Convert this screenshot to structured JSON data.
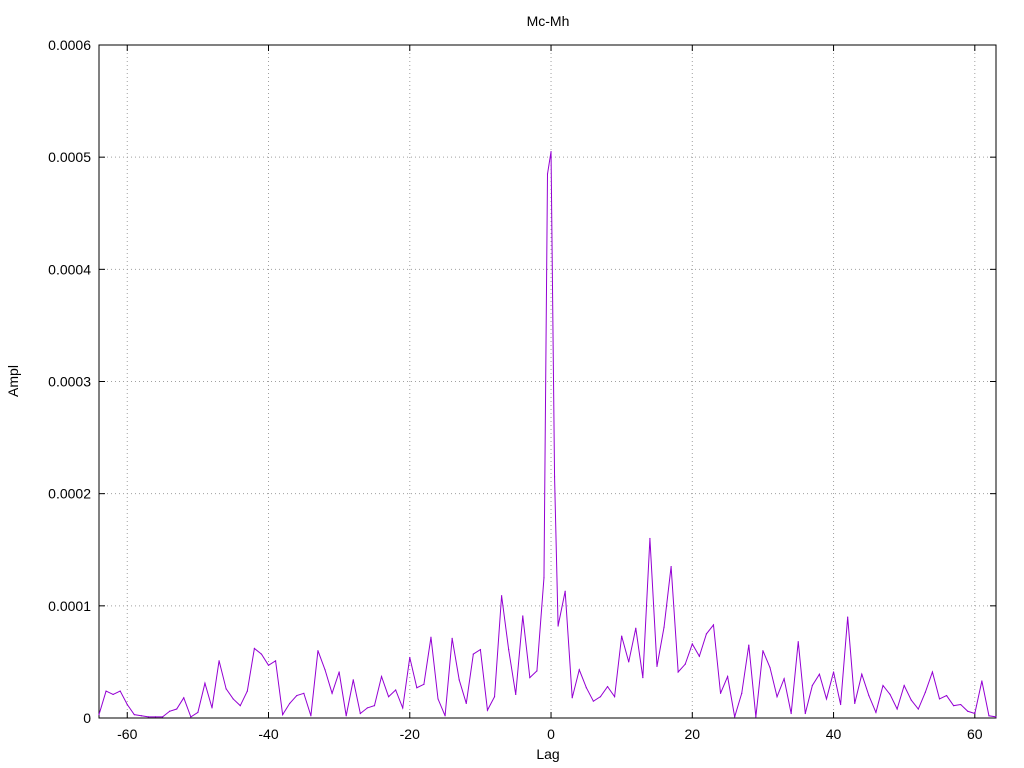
{
  "chart_data": {
    "type": "line",
    "title": "Mc-Mh",
    "xlabel": "Lag",
    "ylabel": "Ampl",
    "xlim": [
      -64,
      63
    ],
    "ylim": [
      0,
      0.0006
    ],
    "grid": true,
    "x_ticks": [
      -60,
      -40,
      -20,
      0,
      20,
      40,
      60
    ],
    "y_ticks": [
      0,
      0.0001,
      0.0002,
      0.0003,
      0.0004,
      0.0005,
      0.0006
    ],
    "x_tick_labels": [
      "-60",
      "-40",
      "-20",
      "0",
      "20",
      "40",
      "60"
    ],
    "y_tick_labels": [
      "0",
      "0.0001",
      "0.0002",
      "0.0003",
      "0.0004",
      "0.0005",
      "0.0006"
    ],
    "series": [
      {
        "color": "#9400d3",
        "x": [
          -64,
          -63,
          -62,
          -61,
          -60,
          -59,
          -58,
          -57,
          -56,
          -55,
          -54,
          -53,
          -52,
          -51,
          -50,
          -49,
          -48,
          -47,
          -46,
          -45,
          -44,
          -43,
          -42,
          -41,
          -40,
          -39,
          -38,
          -37,
          -36,
          -35,
          -34,
          -33,
          -32,
          -31,
          -30,
          -29,
          -28,
          -27,
          -26,
          -25,
          -24,
          -23,
          -22,
          -21,
          -20,
          -19,
          -18,
          -17,
          -16,
          -15,
          -14,
          -13,
          -12,
          -11,
          -10,
          -9,
          -8,
          -7,
          -6,
          -5,
          -4,
          -3,
          -2,
          -1,
          -0.5,
          0,
          0.5,
          1,
          2,
          3,
          4,
          5,
          6,
          7,
          8,
          9,
          10,
          11,
          12,
          13,
          14,
          15,
          16,
          17,
          18,
          19,
          20,
          21,
          22,
          23,
          24,
          25,
          26,
          27,
          28,
          29,
          30,
          31,
          32,
          33,
          34,
          35,
          36,
          37,
          38,
          39,
          40,
          41,
          42,
          43,
          44,
          45,
          46,
          47,
          48,
          49,
          50,
          51,
          52,
          53,
          54,
          55,
          56,
          57,
          58,
          59,
          60,
          61,
          62,
          63
        ],
        "y": [
          3e-06,
          2.4e-05,
          2.1e-05,
          2.4e-05,
          1.2e-05,
          3e-06,
          2e-06,
          1e-06,
          1e-06,
          1e-06,
          6e-06,
          8e-06,
          1.8e-05,
          1e-06,
          5e-06,
          3.1e-05,
          9e-06,
          5.1e-05,
          2.6e-05,
          1.7e-05,
          1.1e-05,
          2.4e-05,
          6.2e-05,
          5.7e-05,
          4.7e-05,
          5.1e-05,
          3e-06,
          1.3e-05,
          2e-05,
          2.2e-05,
          2e-06,
          6e-05,
          4.3e-05,
          2.2e-05,
          4.1e-05,
          2e-06,
          3.4e-05,
          4e-06,
          9e-06,
          1.1e-05,
          3.7e-05,
          1.9e-05,
          2.5e-05,
          9e-06,
          5.4e-05,
          2.7e-05,
          3e-05,
          7.2e-05,
          1.7e-05,
          2e-06,
          7.1e-05,
          3.4e-05,
          1.3e-05,
          5.7e-05,
          6.1e-05,
          7e-06,
          1.9e-05,
          0.000109,
          6.1e-05,
          2.1e-05,
          9.1e-05,
          3.6e-05,
          4.2e-05,
          0.000125,
          0.000485,
          0.000505,
          0.000215,
          8.2e-05,
          0.000113,
          1.8e-05,
          4.3e-05,
          2.7e-05,
          1.5e-05,
          1.9e-05,
          2.8e-05,
          1.9e-05,
          7.3e-05,
          5e-05,
          8e-05,
          3.6e-05,
          0.00016,
          4.6e-05,
          8.1e-05,
          0.000135,
          4.1e-05,
          4.8e-05,
          6.6e-05,
          5.5e-05,
          7.5e-05,
          8.3e-05,
          2.2e-05,
          3.7e-05,
          1e-06,
          2.2e-05,
          6.5e-05,
          1e-06,
          6e-05,
          4.5e-05,
          1.9e-05,
          3.5e-05,
          4e-06,
          6.8e-05,
          4e-06,
          2.9e-05,
          3.9e-05,
          1.7e-05,
          4.1e-05,
          1.2e-05,
          9e-05,
          1.3e-05,
          3.9e-05,
          2e-05,
          5e-06,
          2.9e-05,
          2.1e-05,
          8e-06,
          2.9e-05,
          1.6e-05,
          8e-06,
          2.3e-05,
          4.1e-05,
          1.7e-05,
          2e-05,
          1.1e-05,
          1.2e-05,
          6e-06,
          4e-06,
          3.3e-05,
          2e-06,
          1e-06
        ]
      }
    ]
  }
}
